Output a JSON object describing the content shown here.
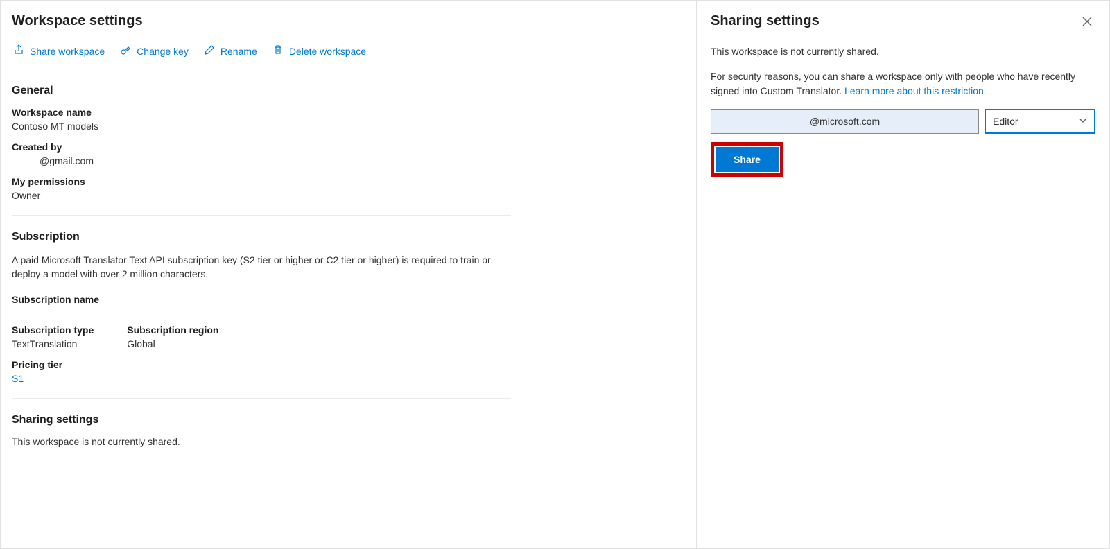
{
  "main": {
    "title": "Workspace settings",
    "actions": {
      "share": "Share workspace",
      "change_key": "Change key",
      "rename": "Rename",
      "delete": "Delete workspace"
    },
    "general": {
      "title": "General",
      "workspace_name_label": "Workspace name",
      "workspace_name_value": "Contoso MT models",
      "created_by_label": "Created by",
      "created_by_value": "@gmail.com",
      "permissions_label": "My permissions",
      "permissions_value": "Owner"
    },
    "subscription": {
      "title": "Subscription",
      "description": "A paid Microsoft Translator Text API subscription key (S2 tier or higher or C2 tier or higher) is required to train or deploy a model with over 2 million characters.",
      "name_label": "Subscription name",
      "type_label": "Subscription type",
      "type_value": "TextTranslation",
      "region_label": "Subscription region",
      "region_value": "Global",
      "pricing_label": "Pricing tier",
      "pricing_value": "S1"
    },
    "sharing": {
      "title": "Sharing settings",
      "status": "This workspace is not currently shared."
    }
  },
  "panel": {
    "title": "Sharing settings",
    "status": "This workspace is not currently shared.",
    "info_prefix": "For security reasons, you can share a workspace only with people who have recently signed into Custom Translator. ",
    "info_link": "Learn more about this restriction.",
    "email_value": "@microsoft.com",
    "role_value": "Editor",
    "share_button": "Share"
  }
}
